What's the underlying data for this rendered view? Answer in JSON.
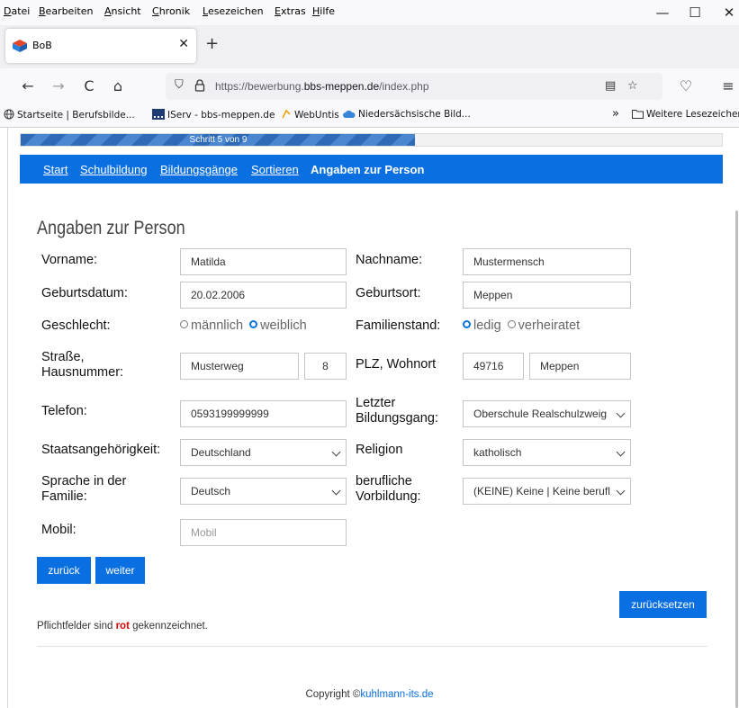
{
  "browser": {
    "menu": [
      {
        "key": "D",
        "rest": "atei"
      },
      {
        "key": "B",
        "rest": "earbeiten"
      },
      {
        "key": "A",
        "rest": "nsicht"
      },
      {
        "key": "C",
        "rest": "hronik"
      },
      {
        "key": "L",
        "rest": "esezeichen"
      },
      {
        "key": "E",
        "rest": "xtras",
        "pre": ""
      },
      {
        "key": "H",
        "rest": "ilfe"
      }
    ],
    "menu_text": [
      "Datei",
      "Bearbeiten",
      "Ansicht",
      "Chronik",
      "Lesezeichen",
      "Extras",
      "Hilfe"
    ],
    "window_controls": {
      "minimize": "—",
      "maximize": "☐",
      "close": "✕"
    },
    "tab": {
      "title": "BoB",
      "close": "✕",
      "favicon": "bob-favicon"
    },
    "new_tab": "+",
    "nav": {
      "back": "←",
      "forward": "→",
      "reload": "C",
      "home": "⌂"
    },
    "url": {
      "prefix": "https://bewerbung.",
      "domain": "bbs-meppen.de",
      "path": "/index.php"
    },
    "url_icons": {
      "shield": "⛉",
      "reader": "▤",
      "star": "☆",
      "pocket": "♡",
      "menu": "≡"
    },
    "bookmarks": [
      {
        "label": "Startseite | Berufsbilde...",
        "icon": "globe-icon"
      },
      {
        "label": "IServ - bbs-meppen.de",
        "icon": "iserv-icon"
      },
      {
        "label": "WebUntis",
        "icon": "webuntis-icon"
      },
      {
        "label": "Niedersächsische Bild...",
        "icon": "cloud-icon"
      }
    ],
    "bookmarks_overflow": "»",
    "other_bookmarks": "Weitere Lesezeichen"
  },
  "page": {
    "progress": {
      "label": "Schritt 5 von 9",
      "fraction": 0.5625
    },
    "steps": [
      "Start",
      "Schulbildung",
      "Bildungsgänge",
      "Sortieren",
      "Angaben zur Person"
    ],
    "heading": "Angaben zur Person",
    "form": {
      "vorname": {
        "label": "Vorname:",
        "value": "Matilda"
      },
      "nachname": {
        "label": "Nachname:",
        "value": "Mustermensch"
      },
      "geburtsdatum": {
        "label": "Geburtsdatum:",
        "value": "20.02.2006"
      },
      "geburtsort": {
        "label": "Geburtsort:",
        "value": "Meppen"
      },
      "geschlecht": {
        "label": "Geschlecht:",
        "options": [
          "männlich",
          "weiblich"
        ],
        "selected": "weiblich"
      },
      "familienstand": {
        "label": "Familienstand:",
        "options": [
          "ledig",
          "verheiratet"
        ],
        "selected": "ledig"
      },
      "strasse": {
        "label_line1": "Straße,",
        "label_line2": "Hausnummer:",
        "street": "Musterweg",
        "number": "8"
      },
      "plz": {
        "label": "PLZ, Wohnort",
        "plz": "49716",
        "ort": "Meppen"
      },
      "telefon": {
        "label": "Telefon:",
        "value": "0593199999999"
      },
      "letzter_bildungsgang": {
        "label_line1": "Letzter",
        "label_line2": "Bildungsgang:",
        "value": "Oberschule Realschulzweig"
      },
      "staatsangehoerigkeit": {
        "label": "Staatsangehörigkeit:",
        "value": "Deutschland"
      },
      "religion": {
        "label": "Religion",
        "value": "katholisch"
      },
      "sprache": {
        "label_line1": "Sprache in der",
        "label_line2": "Familie:",
        "value": "Deutsch"
      },
      "vorbildung": {
        "label_line1": "berufliche",
        "label_line2": "Vorbildung:",
        "value": "(KEINE) Keine | Keine berufl"
      },
      "mobil": {
        "label": "Mobil:",
        "placeholder": "Mobil"
      }
    },
    "buttons": {
      "back": "zurück",
      "next": "weiter",
      "reset": "zurücksetzen"
    },
    "note": {
      "pre": "Pflichtfelder sind ",
      "highlight": "rot",
      "post": " gekennzeichnet."
    },
    "footer": {
      "pre": "Copyright ©",
      "link": "kuhlmann-its.de"
    },
    "colors": {
      "primary": "#0a6fe0",
      "required": "#e00000"
    }
  }
}
